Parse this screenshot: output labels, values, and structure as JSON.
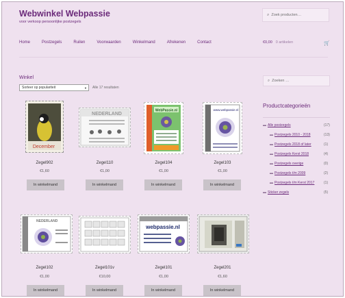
{
  "header": {
    "site_title": "Webwinkel Webpassie",
    "site_description": "voor verkoop persoonlijke postzegels",
    "search_placeholder": "Zoek producten…",
    "nav": [
      "Home",
      "Postzegels",
      "Ruilen",
      "Voorwaarden",
      "Winkelmand",
      "Afrekenen",
      "Contact"
    ],
    "cart_amount": "€0,00",
    "cart_count": "0 artikelen"
  },
  "shop": {
    "title": "Winkel",
    "sort_value": "Sorteer op populariteit",
    "result_count": "Alle 17 resultaten",
    "button_label": "In winkelmand",
    "products": [
      {
        "name": "Zegel902",
        "price": "€1,60",
        "stamp_text": "December"
      },
      {
        "name": "Zegel110",
        "price": "€1,00",
        "stamp_text": "NEDERLAND"
      },
      {
        "name": "Zegel104",
        "price": "€1,00",
        "stamp_text": "WebPassie.nl"
      },
      {
        "name": "Zegel103",
        "price": "€1,00",
        "stamp_text": "www.webpassie.nl"
      },
      {
        "name": "Zegel102",
        "price": "€1,00",
        "stamp_text": "NEDERLAND"
      },
      {
        "name": "Zegel101v",
        "price": "€10,00",
        "stamp_text": ""
      },
      {
        "name": "Zegel101",
        "price": "€1,00",
        "stamp_text": "webpassie.nl"
      },
      {
        "name": "Zegel201",
        "price": "€1,60",
        "stamp_text": ""
      }
    ]
  },
  "sidebar": {
    "search_placeholder": "Zoeken …",
    "categories_title": "Productcategorieën",
    "categories": [
      {
        "label": "Alle postzegels",
        "count": "(17)"
      },
      {
        "label": "Postzegels 2010 - 2018",
        "count": "(13)"
      },
      {
        "label": "Postzegels 2018 of later",
        "count": "(1)"
      },
      {
        "label": "Postzegels Kerst 2018",
        "count": "(4)"
      },
      {
        "label": "Postzegels overige",
        "count": "(0)"
      },
      {
        "label": "Postzegels t/m 2009",
        "count": "(2)"
      },
      {
        "label": "Postzegels t/m Kerst 2017",
        "count": "(1)"
      },
      {
        "label": "Sticker zegels",
        "count": "(5)"
      }
    ]
  }
}
